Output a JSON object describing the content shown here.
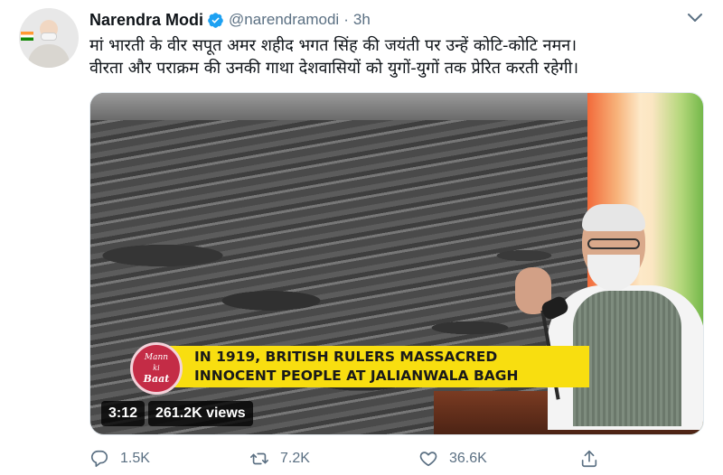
{
  "author": {
    "name": "Narendra Modi",
    "handle": "@narendramodi",
    "separator": "·",
    "time": "3h"
  },
  "tweet": {
    "lines": [
      "मां भारती के वीर सपूत अमर शहीद भगत सिंह की जयंती पर उन्हें कोटि-कोटि नमन।",
      "वीरता और पराक्रम की उनकी गाथा देशवासियों को युगों-युगों तक प्रेरित करती रहेगी।"
    ]
  },
  "video": {
    "caption_lines": [
      "IN 1919, BRITISH RULERS MASSACRED",
      "INNOCENT PEOPLE AT JALIANWALA BAGH"
    ],
    "logo": {
      "line1": "Mann",
      "line2": "ki",
      "line3": "Baat"
    },
    "duration": "3:12",
    "views": "261.2K views"
  },
  "actions": {
    "reply": {
      "icon": "reply-icon",
      "count": "1.5K"
    },
    "retweet": {
      "icon": "retweet-icon",
      "count": "7.2K"
    },
    "like": {
      "icon": "like-icon",
      "count": "36.6K"
    },
    "share": {
      "icon": "share-icon"
    }
  },
  "colors": {
    "verified": "#1da1f2",
    "secondary_text": "#5b7083",
    "caption_banner": "#f8de10",
    "logo": "#c42c46"
  }
}
